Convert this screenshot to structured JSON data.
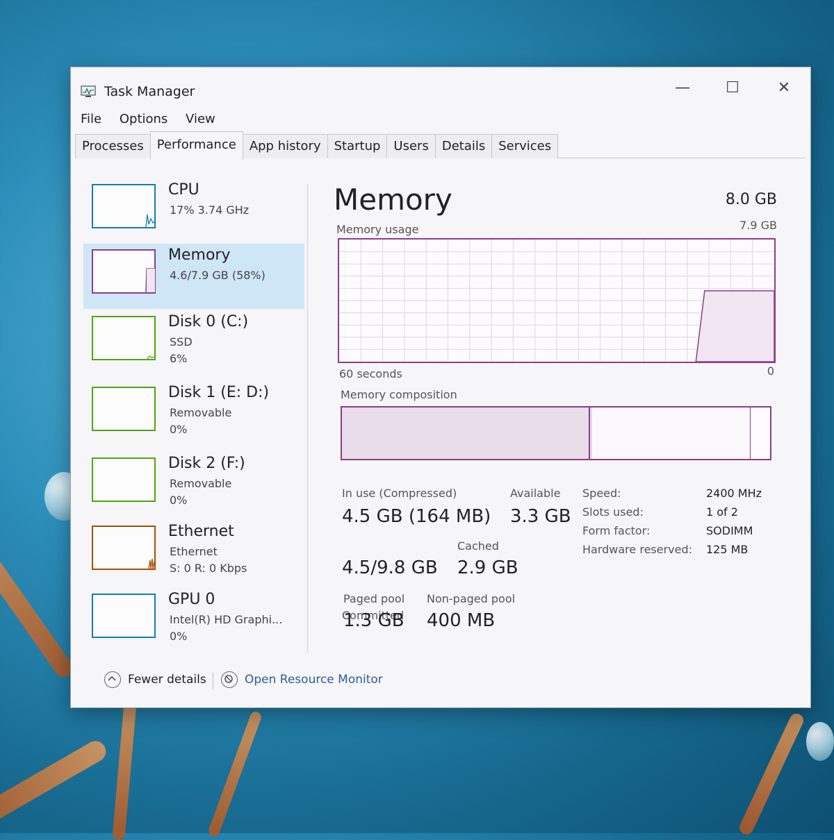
{
  "window": {
    "title": "Task Manager",
    "controls": {
      "minimize": "—",
      "maximize": "☐",
      "close": "✕"
    }
  },
  "menu": [
    "File",
    "Options",
    "View"
  ],
  "tabs": [
    {
      "label": "Processes"
    },
    {
      "label": "Performance",
      "active": true
    },
    {
      "label": "App history"
    },
    {
      "label": "Startup"
    },
    {
      "label": "Users"
    },
    {
      "label": "Details"
    },
    {
      "label": "Services"
    }
  ],
  "sidebar": {
    "items": [
      {
        "name": "CPU",
        "line1": "17% 3.74 GHz",
        "line2": "",
        "color": "#117dbb"
      },
      {
        "name": "Memory",
        "line1": "4.6/7.9 GB (58%)",
        "line2": "",
        "color": "#8b3d8b",
        "selected": true
      },
      {
        "name": "Disk 0 (C:)",
        "line1": "SSD",
        "line2": "6%",
        "color": "#4da60c"
      },
      {
        "name": "Disk 1 (E: D:)",
        "line1": "Removable",
        "line2": "0%",
        "color": "#4da60c"
      },
      {
        "name": "Disk 2 (F:)",
        "line1": "Removable",
        "line2": "0%",
        "color": "#4da60c"
      },
      {
        "name": "Ethernet",
        "line1": "Ethernet",
        "line2": "S: 0 R: 0 Kbps",
        "color": "#a74f01"
      },
      {
        "name": "GPU 0",
        "line1": "Intel(R) HD Graphi...",
        "line2": "0%",
        "color": "#117dbb"
      }
    ]
  },
  "main": {
    "title": "Memory",
    "total": "8.0 GB",
    "usage_label": "Memory usage",
    "usage_max": "7.9 GB",
    "axis_left": "60 seconds",
    "axis_right": "0",
    "composition_label": "Memory composition",
    "accent": "#8b3d8b",
    "usage_fraction": 0.58,
    "composition": {
      "in_use_fraction": 0.58,
      "modified_fraction": 0.005,
      "standby_fraction": 0.37
    },
    "stats": {
      "in_use_label": "In use (Compressed)",
      "in_use_value": "4.5 GB (164 MB)",
      "available_label": "Available",
      "available_value": "3.3 GB",
      "committed_label": "Committed",
      "committed_value": "4.5/9.8 GB",
      "cached_label": "Cached",
      "cached_value": "2.9 GB",
      "paged_label": "Paged pool",
      "paged_value": "1.3 GB",
      "nonpaged_label": "Non-paged pool",
      "nonpaged_value": "400 MB"
    },
    "details": [
      {
        "label": "Speed:",
        "value": "2400 MHz"
      },
      {
        "label": "Slots used:",
        "value": "1 of 2"
      },
      {
        "label": "Form factor:",
        "value": "SODIMM"
      },
      {
        "label": "Hardware reserved:",
        "value": "125 MB"
      }
    ]
  },
  "footer": {
    "fewer_details": "Fewer details",
    "open_resource_monitor": "Open Resource Monitor"
  }
}
